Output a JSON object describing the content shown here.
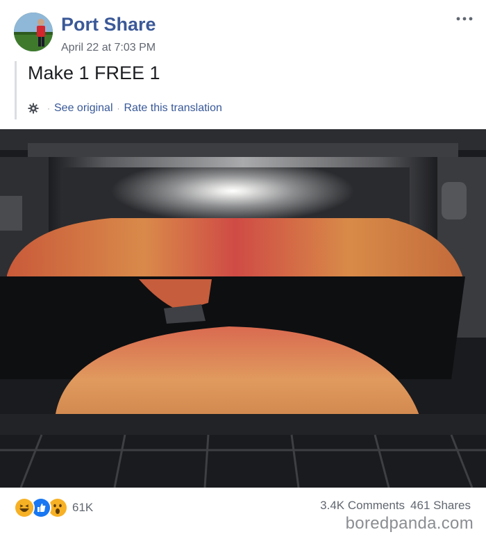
{
  "post": {
    "author": "Port Share",
    "timestamp": "April 22 at 7:03 PM",
    "text": "Make 1 FREE 1",
    "more_icon": "more-horizontal-icon"
  },
  "translation": {
    "icon": "gear-icon",
    "see_original": "See original",
    "separator": "·",
    "rate": "Rate this translation"
  },
  "footer": {
    "reaction_icons": [
      "haha-icon",
      "like-icon",
      "wow-icon"
    ],
    "reaction_count": "61K",
    "comments": "3.4K Comments",
    "shares": "461 Shares"
  },
  "watermark": "boredpanda.com",
  "colors": {
    "author_link": "#3b5998",
    "translation_link": "#385898",
    "meta_text": "#616770",
    "like_blue": "#1877f2",
    "emoji_yellow": "#f7b125"
  }
}
